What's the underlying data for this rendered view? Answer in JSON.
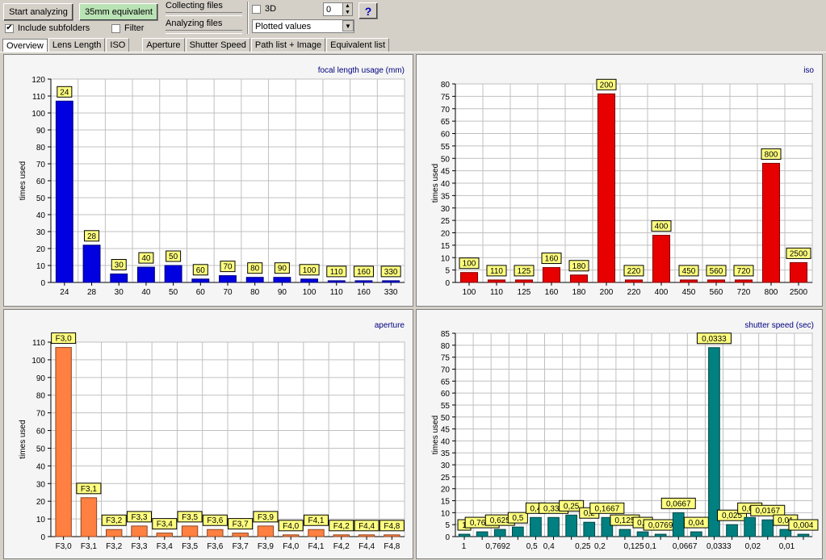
{
  "toolbar": {
    "start_label": "Start analyzing",
    "equiv_label": "35mm equivalent",
    "subfolders_label": "Include subfolders",
    "subfolders_checked": "✔",
    "filter_label": "Filter",
    "collecting_label": "Collecting files",
    "analyzing_label": "Analyzing files",
    "threed_label": "3D",
    "spin_value": "0",
    "plot_select_value": "Plotted values",
    "help_label": "?"
  },
  "tabs": [
    "Overview",
    "Lens Length",
    "ISO",
    "Aperture",
    "Shutter Speed",
    "Path list + Image",
    "Equivalent list"
  ],
  "chart_data": [
    {
      "type": "bar",
      "title": "focal length usage (mm)",
      "ylabel": "times used",
      "ylim": [
        0,
        120
      ],
      "yticks": [
        0,
        10,
        20,
        30,
        40,
        50,
        60,
        70,
        80,
        90,
        100,
        110,
        120
      ],
      "color": "#0000e0",
      "categories": [
        "24",
        "28",
        "30",
        "40",
        "50",
        "60",
        "70",
        "80",
        "90",
        "100",
        "110",
        "160",
        "330"
      ],
      "labels": [
        "24",
        "28",
        "30",
        "40",
        "50",
        "60",
        "70",
        "80",
        "90",
        "100",
        "110",
        "160",
        "330"
      ],
      "values": [
        107,
        22,
        5,
        9,
        10,
        2,
        4,
        3,
        3,
        2,
        1,
        1,
        1
      ]
    },
    {
      "type": "bar",
      "title": "iso",
      "ylabel": "times used",
      "ylim": [
        0,
        80
      ],
      "yticks": [
        0,
        5,
        10,
        15,
        20,
        25,
        30,
        35,
        40,
        45,
        50,
        55,
        60,
        65,
        70,
        75,
        80
      ],
      "color": "#e60000",
      "categories": [
        "100",
        "110",
        "125",
        "160",
        "180",
        "200",
        "220",
        "400",
        "450",
        "560",
        "720",
        "800",
        "2500"
      ],
      "labels": [
        "100",
        "110",
        "125",
        "160",
        "180",
        "200",
        "220",
        "400",
        "450",
        "560",
        "720",
        "800",
        "2500"
      ],
      "values": [
        4,
        1,
        1,
        6,
        3,
        76,
        1,
        19,
        1,
        1,
        1,
        48,
        8
      ]
    },
    {
      "type": "bar",
      "title": "aperture",
      "ylabel": "times used",
      "ylim": [
        0,
        110
      ],
      "yticks": [
        0,
        10,
        20,
        30,
        40,
        50,
        60,
        70,
        80,
        90,
        100,
        110
      ],
      "color": "#ff8040",
      "categories": [
        "F3,0",
        "F3,1",
        "F3,2",
        "F3,3",
        "F3,4",
        "F3,5",
        "F3,6",
        "F3,7",
        "F3,9",
        "F4,0",
        "F4,1",
        "F4,2",
        "F4,4",
        "F4,8"
      ],
      "labels": [
        "F3,0",
        "F3,1",
        "F3,2",
        "F3,3",
        "F3,4",
        "F3,5",
        "F3,6",
        "F3,7",
        "F3,9",
        "F4,0",
        "F4,1",
        "F4,2",
        "F4,4",
        "F4,8"
      ],
      "values": [
        107,
        22,
        4,
        6,
        2,
        6,
        4,
        2,
        6,
        1,
        4,
        1,
        1,
        1
      ]
    },
    {
      "type": "bar",
      "title": "shutter speed (sec)",
      "ylabel": "times used",
      "ylim": [
        0,
        85
      ],
      "yticks": [
        0,
        5,
        10,
        15,
        20,
        25,
        30,
        35,
        40,
        45,
        50,
        55,
        60,
        65,
        70,
        75,
        80,
        85
      ],
      "color": "#008080",
      "categories": [
        "1",
        "",
        "0,7692",
        "",
        "0,5",
        "0,4",
        "",
        "0,25",
        "0,2",
        "",
        "0,125",
        "0,1",
        "",
        "0,0667",
        "",
        "0,0333",
        "",
        "0,02",
        "",
        "0,01",
        ""
      ],
      "labels": [
        "1",
        "0,7692",
        "0,625",
        "0,5",
        "0,4",
        "0,333",
        "0,25",
        "0,2",
        "0,1667",
        "0,125",
        "0,1",
        "0,0769",
        "0,0667",
        "0,04",
        "0,0333",
        "0,025",
        "0,02",
        "0,0167",
        "0,01",
        "0,004"
      ],
      "label_index": [
        0,
        1,
        2,
        3,
        4,
        5,
        6,
        7,
        8,
        9,
        10,
        11,
        12,
        13,
        14,
        15,
        16,
        17,
        18,
        19
      ],
      "values": [
        1,
        2,
        3,
        4,
        8,
        8,
        9,
        6,
        8,
        3,
        2,
        1,
        10,
        2,
        79,
        5,
        8,
        7,
        3,
        1
      ]
    }
  ]
}
